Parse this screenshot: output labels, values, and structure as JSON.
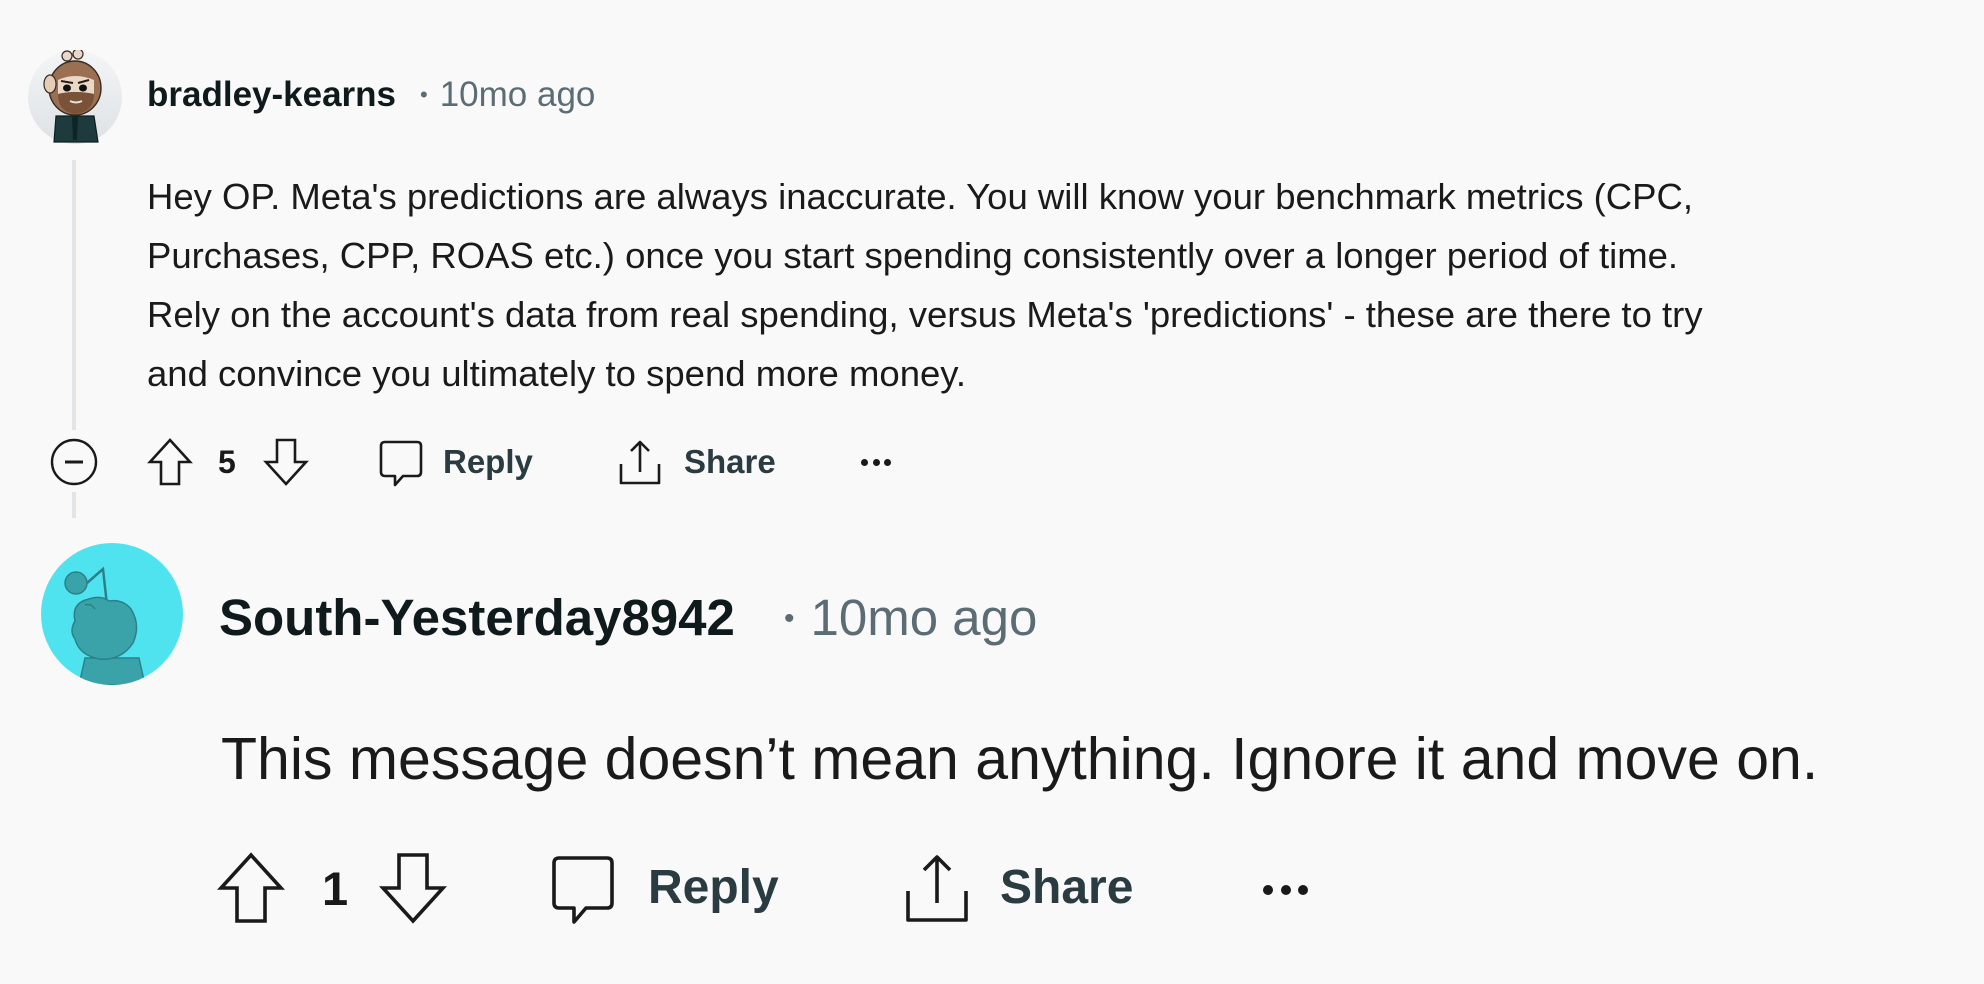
{
  "comments": [
    {
      "username": "bradley-kearns",
      "separator": "•",
      "timestamp": "10mo ago",
      "avatar": "bearded-snoo-avatar",
      "body_lines": [
        "Hey OP. Meta's predictions are always inaccurate. You will know your benchmark metrics (CPC,",
        "Purchases, CPP, ROAS etc.) once you start spending consistently over a longer period of time.",
        "Rely on the account's data from real spending, versus Meta's 'predictions' - these are there to try",
        "and convince you ultimately to spend more money."
      ],
      "collapse_icon": "collapse-minus-circle-icon",
      "upvote_icon": "arrow-up-outline-icon",
      "votes": "5",
      "downvote_icon": "arrow-down-outline-icon",
      "reply_icon": "speech-bubble-icon",
      "reply_label": "Reply",
      "share_icon": "share-upload-icon",
      "share_label": "Share",
      "more_icon": "ellipsis-icon"
    },
    {
      "username": "South-Yesterday8942",
      "separator": "•",
      "timestamp": "10mo ago",
      "avatar": "default-cyan-snoo-avatar",
      "body_lines": [
        "This message doesn’t mean anything. Ignore it and move on."
      ],
      "upvote_icon": "arrow-up-outline-icon",
      "votes": "1",
      "downvote_icon": "arrow-down-outline-icon",
      "reply_icon": "speech-bubble-icon",
      "reply_label": "Reply",
      "share_icon": "share-upload-icon",
      "share_label": "Share",
      "more_icon": "ellipsis-icon"
    }
  ],
  "colors": {
    "background": "#f9f9f9",
    "text": "#1a1a1b",
    "meta": "#5c6c74",
    "thread_line": "#e2e4e6",
    "avatar2_bg": "#4fe3f0",
    "avatar2_snoo": "#3aa2a9"
  }
}
